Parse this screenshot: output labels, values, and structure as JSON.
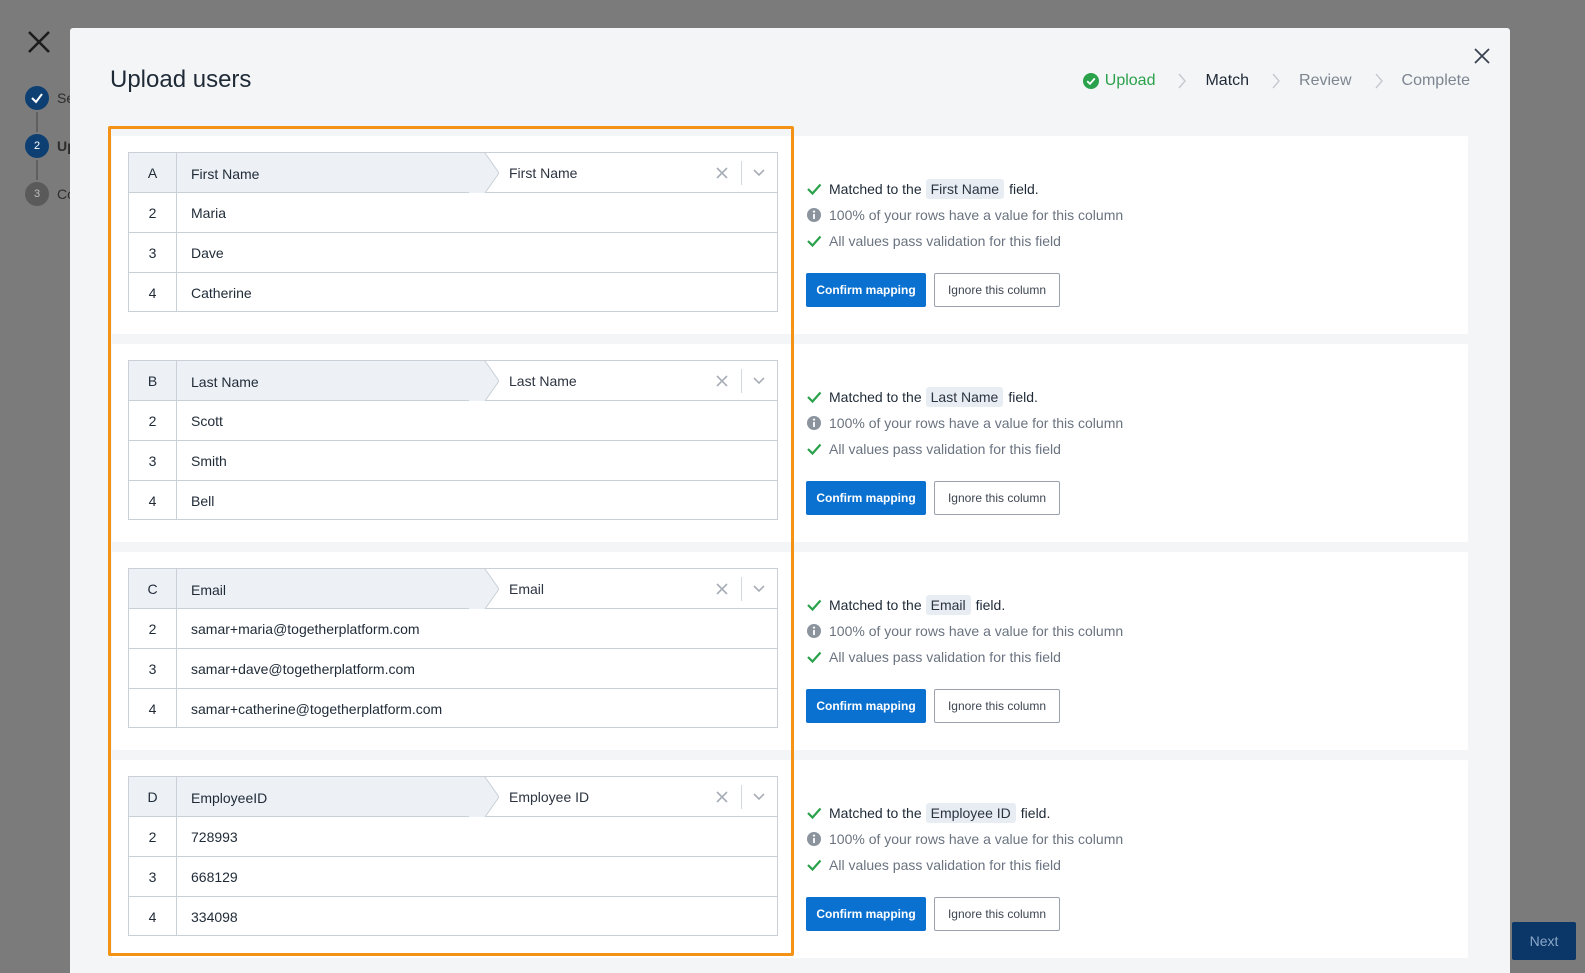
{
  "background": {
    "steps": [
      {
        "number": "",
        "label": "Se",
        "state": "done"
      },
      {
        "number": "2",
        "label": "Up",
        "state": "current"
      },
      {
        "number": "3",
        "label": "Co",
        "state": "todo"
      }
    ],
    "next_label": "Next"
  },
  "modal": {
    "title": "Upload users",
    "stepper": [
      {
        "label": "Upload",
        "state": "done"
      },
      {
        "label": "Match",
        "state": "active"
      },
      {
        "label": "Review",
        "state": "todo"
      },
      {
        "label": "Complete",
        "state": "todo"
      }
    ]
  },
  "mappings": [
    {
      "column_letter": "A",
      "column_name": "First Name",
      "field": "First Name",
      "rows": [
        {
          "num": "2",
          "value": "Maria"
        },
        {
          "num": "3",
          "value": "Dave"
        },
        {
          "num": "4",
          "value": "Catherine"
        }
      ],
      "matched_prefix": "Matched to the",
      "matched_field": "First Name",
      "matched_suffix": "field.",
      "coverage": "100% of your rows have a value for this column",
      "validation": "All values pass validation for this field",
      "confirm_label": "Confirm mapping",
      "ignore_label": "Ignore this column"
    },
    {
      "column_letter": "B",
      "column_name": "Last Name",
      "field": "Last Name",
      "rows": [
        {
          "num": "2",
          "value": "Scott"
        },
        {
          "num": "3",
          "value": "Smith"
        },
        {
          "num": "4",
          "value": "Bell"
        }
      ],
      "matched_prefix": "Matched to the",
      "matched_field": "Last Name",
      "matched_suffix": "field.",
      "coverage": "100% of your rows have a value for this column",
      "validation": "All values pass validation for this field",
      "confirm_label": "Confirm mapping",
      "ignore_label": "Ignore this column"
    },
    {
      "column_letter": "C",
      "column_name": "Email",
      "field": "Email",
      "rows": [
        {
          "num": "2",
          "value": "samar+maria@togetherplatform.com"
        },
        {
          "num": "3",
          "value": "samar+dave@togetherplatform.com"
        },
        {
          "num": "4",
          "value": "samar+catherine@togetherplatform.com"
        }
      ],
      "matched_prefix": "Matched to the",
      "matched_field": "Email",
      "matched_suffix": "field.",
      "coverage": "100% of your rows have a value for this column",
      "validation": "All values pass validation for this field",
      "confirm_label": "Confirm mapping",
      "ignore_label": "Ignore this column"
    },
    {
      "column_letter": "D",
      "column_name": "EmployeeID",
      "field": "Employee ID",
      "rows": [
        {
          "num": "2",
          "value": "728993"
        },
        {
          "num": "3",
          "value": "668129"
        },
        {
          "num": "4",
          "value": "334098"
        }
      ],
      "matched_prefix": "Matched to the",
      "matched_field": "Employee ID",
      "matched_suffix": "field.",
      "coverage": "100% of your rows have a value for this column",
      "validation": "All values pass validation for this field",
      "confirm_label": "Confirm mapping",
      "ignore_label": "Ignore this column"
    }
  ],
  "colors": {
    "primary": "#0a71d0",
    "success": "#2aa14b",
    "highlight": "#f39214",
    "header_bg": "#edf1f6"
  }
}
